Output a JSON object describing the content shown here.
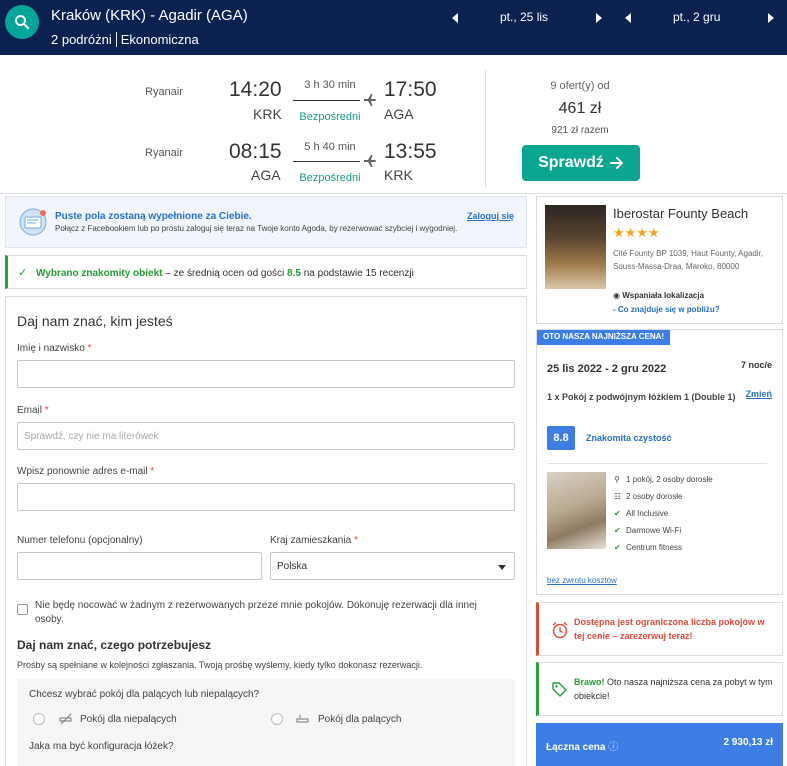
{
  "search": {
    "route": "Kraków (KRK) - Agadir (AGA)",
    "travellers": "2 podróżni",
    "cabin": "Ekonomiczna",
    "depart_date": "pt., 25 lis",
    "return_date": "pt., 2 gru"
  },
  "flights": [
    {
      "airline": "Ryanair",
      "dep_time": "14:20",
      "dep_code": "KRK",
      "duration": "3 h 30 min",
      "stops": "Bezpośredni",
      "arr_time": "17:50",
      "arr_code": "AGA"
    },
    {
      "airline": "Ryanair",
      "dep_time": "08:15",
      "dep_code": "AGA",
      "duration": "5 h 40 min",
      "stops": "Bezpośredni",
      "arr_time": "13:55",
      "arr_code": "KRK"
    }
  ],
  "offer": {
    "count": "9 ofert(y) od",
    "price": "461 zł",
    "total": "921 zł razem",
    "button": "Sprawdź"
  },
  "facebook": {
    "title": "Puste pola zostaną wypełnione za Ciebie.",
    "text": "Połącz z Facebookiem lub po prostu zaloguj się teraz na Twoje konto Agoda, by rezerwować szybciej i wygodniej.",
    "login": "Zaloguj się"
  },
  "rating_note": {
    "highlight": "Wybrano znakomity obiekt",
    "text_before": " – ze średnią ocen od gości ",
    "score": "8.5",
    "text_after": " na podstawie 15 recenzji"
  },
  "form": {
    "heading": "Daj nam znać, kim jesteś",
    "name_label": "Imię i nazwisko",
    "email_label": "Email",
    "email_placeholder": "Sprawdź, czy nie ma literówek",
    "email_repeat_label": "Wpisz ponownie adres e-mail",
    "phone_label": "Numer telefonu (opcjonalny)",
    "country_label": "Kraj zamieszkania",
    "country_value": "Polska",
    "required_mark": "*",
    "not_staying": "Nie będę nocować w żadnym z rezerwowanych przeze mnie pokojów. Dokonuję rezerwacji dla innej osoby.",
    "needs_heading": "Daj nam znać, czego potrzebujesz",
    "needs_text": "Prośby są spełniane w kolejności zgłaszania. Twoją prośbę wyślemy, kiedy tylko dokonasz rezerwacji.",
    "smoking_question": "Chcesz wybrać pokój dla palących lub niepalących?",
    "non_smoking": "Pokój dla niepalących",
    "smoking": "Pokój dla palących",
    "bed_question": "Jaka ma być konfiguracja łóżek?"
  },
  "hotel": {
    "name": "Iberostar Founty Beach",
    "stars": "★★★★",
    "address": "Cité Founty BP 1039, Haut Founty, Agadir, Souss-Massa-Draa, Maroko, 80000",
    "location": "Wspaniała lokalizacja",
    "nearby": "- Co znajduje się w pobliżu?"
  },
  "price_card": {
    "badge": "OTO NASZA NAJNIŻSZA CENA!",
    "dates": "25 lis 2022 - 2 gru 2022",
    "nights": "7 noc/e",
    "room": "1 x Pokój z podwójnym łóżkiem 1 (Double 1)",
    "change": "Zmień",
    "score": "8.8",
    "score_text": "Znakomita czystość",
    "features": [
      {
        "icon": "person-icon",
        "text": "1 pokój, 2 osoby dorosłe"
      },
      {
        "icon": "bed-icon",
        "text": "2 osoby dorosłe"
      },
      {
        "icon": "check-icon",
        "text": "All Inclusive"
      },
      {
        "icon": "check-icon",
        "text": "Darmowe Wi-Fi"
      },
      {
        "icon": "check-icon",
        "text": "Centrum fitness"
      }
    ],
    "no_refund": "bez zwrotu kosztów"
  },
  "alert": {
    "text": "Dostępna jest ograniczona liczba pokojów w tej cenie – zarezerwuj teraz!"
  },
  "bravo": {
    "highlight": "Brawo!",
    "text": " Oto nasza najniższa cena za pobyt w tym obiekcie!"
  },
  "total": {
    "label": "Łączna cena",
    "value": "2 930,13 zł"
  },
  "colors": {
    "navy": "#0b2150",
    "teal": "#00a698",
    "blue": "#3c7de6",
    "green": "#2aa13f",
    "red": "#e04a3a"
  }
}
